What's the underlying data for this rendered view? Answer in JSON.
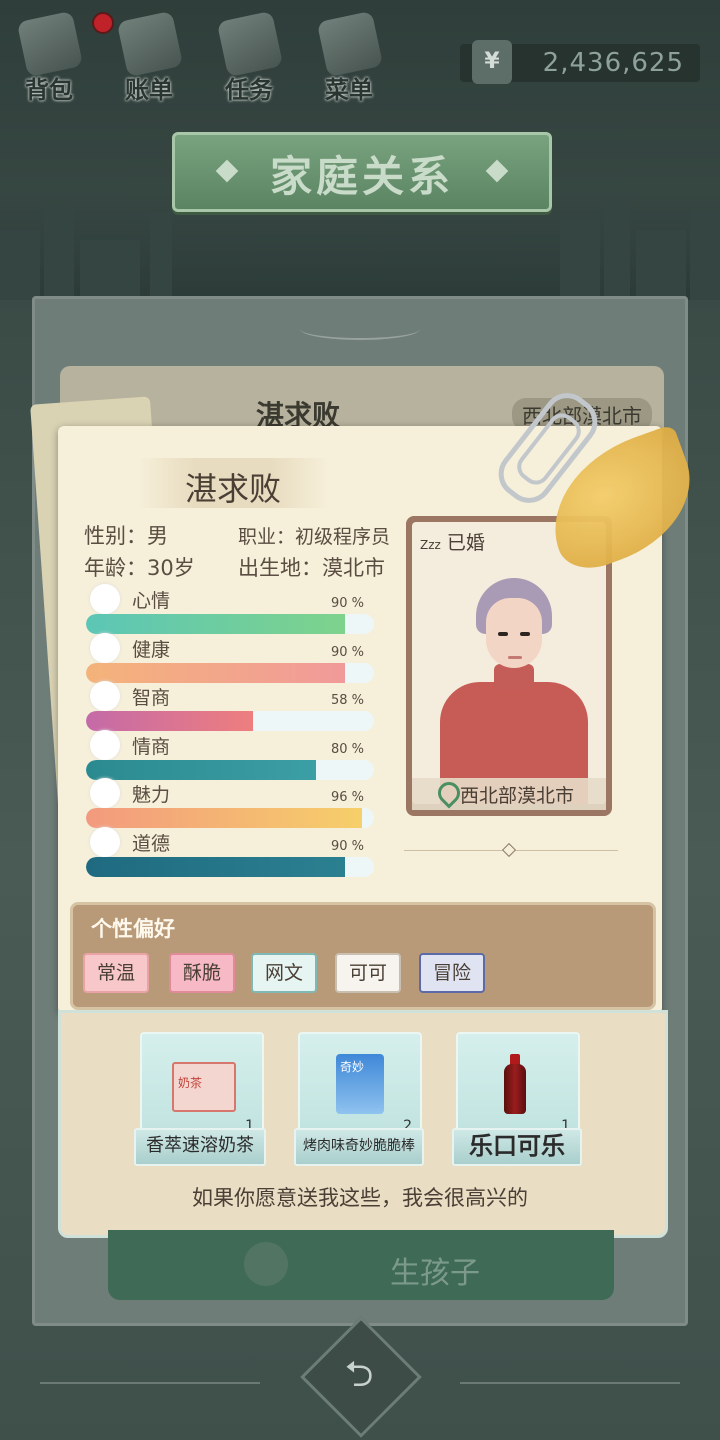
{
  "topbar": {
    "items": [
      {
        "label": "背包",
        "icon": "bag-icon",
        "badge": true
      },
      {
        "label": "账单",
        "icon": "bill-icon"
      },
      {
        "label": "任务",
        "icon": "task-icon"
      },
      {
        "label": "菜单",
        "icon": "menu-icon"
      }
    ],
    "currency_symbol": "¥",
    "money": "2,436,625"
  },
  "title": "家庭关系",
  "back_card": {
    "name": "湛求败",
    "location": "西北部漠北市"
  },
  "profile": {
    "name": "湛求败",
    "gender_label": "性别：",
    "gender": "男",
    "job_label": "职业：",
    "job": "初级程序员",
    "age_label": "年龄：",
    "age": "30岁",
    "birthplace_label": "出生地：",
    "birthplace": "漠北市",
    "marital_status": "已婚",
    "sleep_icon": "Zzz",
    "location": "西北部漠北市"
  },
  "stats": [
    {
      "label": "心情",
      "percent": 90,
      "percent_text": "90 %",
      "icon": "smile-icon",
      "colors": [
        "#5cc6b6",
        "#7ed38c"
      ]
    },
    {
      "label": "健康",
      "percent": 90,
      "percent_text": "90 %",
      "icon": "heart-icon",
      "colors": [
        "#f4b37a",
        "#f19a9a"
      ]
    },
    {
      "label": "智商",
      "percent": 58,
      "percent_text": "58 %",
      "icon": "bulb-icon",
      "colors": [
        "#c46aa8",
        "#ee7e7e"
      ]
    },
    {
      "label": "情商",
      "percent": 80,
      "percent_text": "80 %",
      "icon": "apple-icon",
      "colors": [
        "#2a8a8f",
        "#3c9fa5"
      ]
    },
    {
      "label": "魅力",
      "percent": 96,
      "percent_text": "96 %",
      "icon": "sparkle-icon",
      "colors": [
        "#f39a7e",
        "#f6cf6a"
      ]
    },
    {
      "label": "道德",
      "percent": 90,
      "percent_text": "90 %",
      "icon": "scale-icon",
      "colors": [
        "#1f6a80",
        "#2b8090"
      ]
    }
  ],
  "preferences": {
    "title": "个性偏好",
    "tags": [
      {
        "label": "常温",
        "bg": "#f7c7c9",
        "border": "#e9a2a6"
      },
      {
        "label": "酥脆",
        "bg": "#f6b9c5",
        "border": "#e08a9a"
      },
      {
        "label": "网文",
        "bg": "#e6f4f2",
        "border": "#7fb8b5"
      },
      {
        "label": "可可",
        "bg": "#f7f4ef",
        "border": "#c9bfb0"
      },
      {
        "label": "冒险",
        "bg": "#dfe3f2",
        "border": "#5d6aa8"
      }
    ]
  },
  "gifts": [
    {
      "name": "香萃速溶奶茶",
      "count": "1",
      "icon": "milk-tea-box-icon",
      "pack_text": "奶茶"
    },
    {
      "name": "烤肉味奇妙脆脆棒",
      "count": "2",
      "icon": "snack-bag-icon",
      "pack_text": "奇妙"
    },
    {
      "name": "乐口可乐",
      "count": "1",
      "icon": "cola-bottle-icon"
    }
  ],
  "gift_caption": "如果你愿意送我这些，我会很高兴的",
  "action_button": "生孩子",
  "back_icon": "return-icon"
}
